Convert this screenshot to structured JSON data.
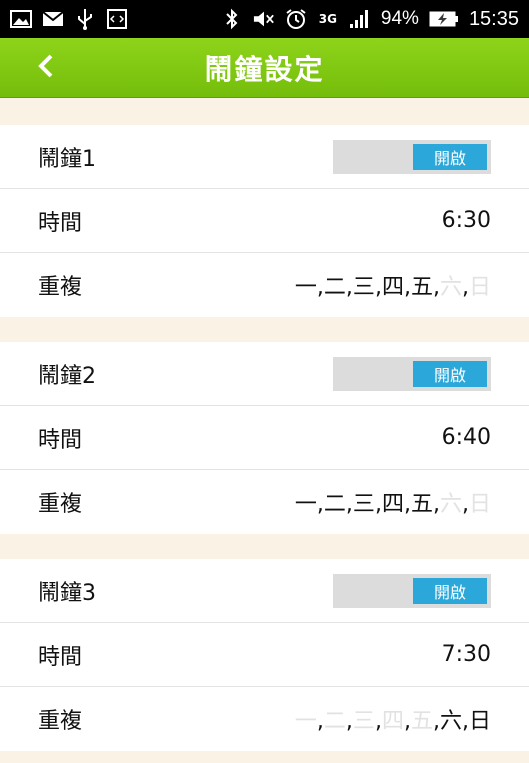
{
  "status_bar": {
    "battery_percent": "94%",
    "time": "15:35",
    "network": "3G",
    "icons": [
      "image-icon",
      "mail-icon",
      "usb-icon",
      "code-icon",
      "bluetooth-icon",
      "mute-icon",
      "alarm-icon",
      "network-3g-icon",
      "signal-icon",
      "battery-charging-icon"
    ]
  },
  "app_bar": {
    "title": "鬧鐘設定",
    "back_icon": "chevron-left-icon"
  },
  "alarms": [
    {
      "name": "鬧鐘1",
      "toggle_label": "開啟",
      "time_label": "時間",
      "time": "6:30",
      "repeat_label": "重複",
      "days": [
        {
          "label": "一",
          "active": true
        },
        {
          "label": "二",
          "active": true
        },
        {
          "label": "三",
          "active": true
        },
        {
          "label": "四",
          "active": true
        },
        {
          "label": "五",
          "active": true
        },
        {
          "label": "六",
          "active": false
        },
        {
          "label": "日",
          "active": false
        }
      ]
    },
    {
      "name": "鬧鐘2",
      "toggle_label": "開啟",
      "time_label": "時間",
      "time": "6:40",
      "repeat_label": "重複",
      "days": [
        {
          "label": "一",
          "active": true
        },
        {
          "label": "二",
          "active": true
        },
        {
          "label": "三",
          "active": true
        },
        {
          "label": "四",
          "active": true
        },
        {
          "label": "五",
          "active": true
        },
        {
          "label": "六",
          "active": false
        },
        {
          "label": "日",
          "active": false
        }
      ]
    },
    {
      "name": "鬧鐘3",
      "toggle_label": "開啟",
      "time_label": "時間",
      "time": "7:30",
      "repeat_label": "重複",
      "days": [
        {
          "label": "一",
          "active": false
        },
        {
          "label": "二",
          "active": false
        },
        {
          "label": "三",
          "active": false
        },
        {
          "label": "四",
          "active": false
        },
        {
          "label": "五",
          "active": false
        },
        {
          "label": "六",
          "active": true
        },
        {
          "label": "日",
          "active": true
        }
      ]
    }
  ],
  "colors": {
    "app_bar": "#7fc90f",
    "toggle_on": "#2ba7d9",
    "toggle_track": "#dcdcdc",
    "background": "#fbf2e6",
    "day_inactive": "#e2e2e2"
  }
}
